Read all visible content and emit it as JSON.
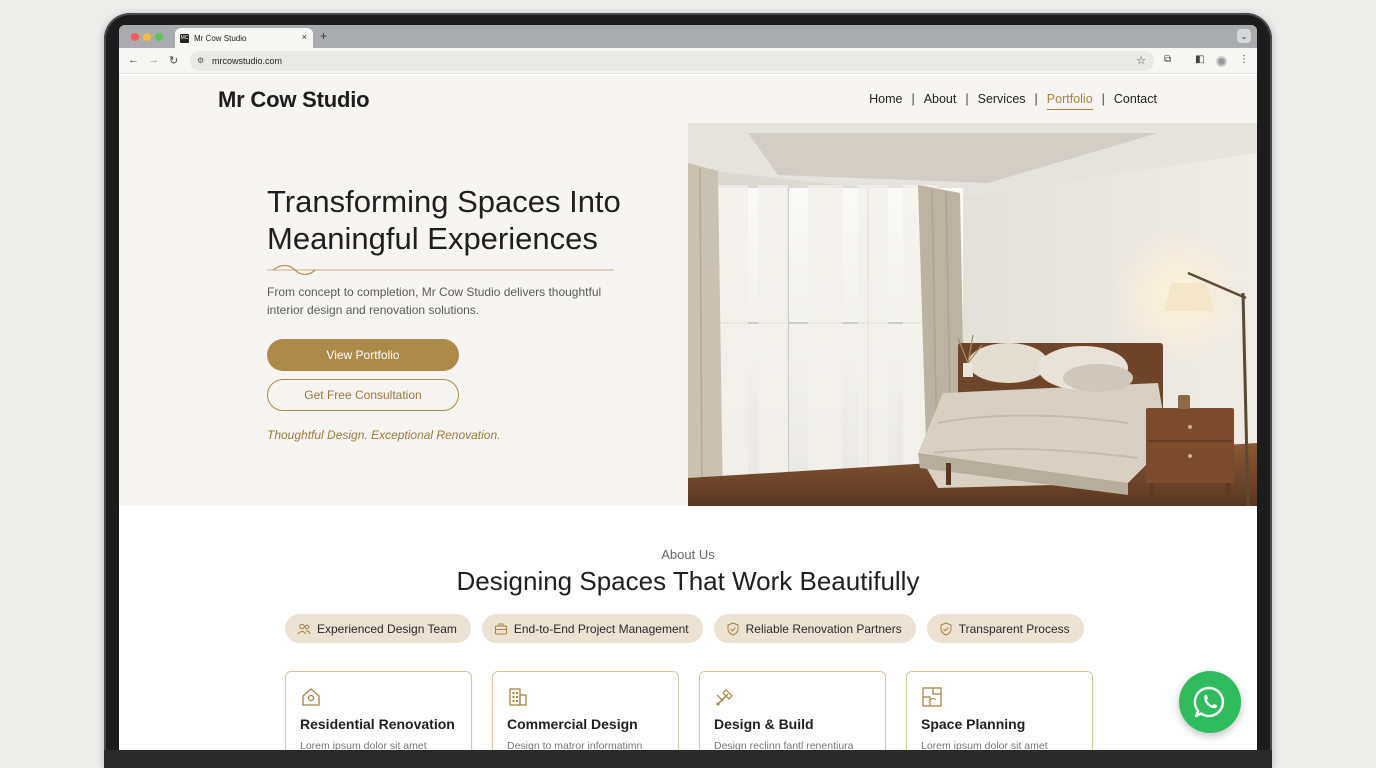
{
  "browser": {
    "tab_title": "Mr Cow Studio",
    "favicon_text": "MC",
    "tab_close": "×",
    "new_tab": "+",
    "url": "mrcowstudio.com"
  },
  "site": {
    "brand": "Mr Cow Studio",
    "nav": [
      {
        "label": "Home"
      },
      {
        "label": "About"
      },
      {
        "label": "Services"
      },
      {
        "label": "Portfolio",
        "active": true
      },
      {
        "label": "Contact"
      }
    ],
    "nav_separator": "|"
  },
  "hero": {
    "title_line1": "Transforming Spaces Into",
    "title_line2": "Meaningful Experiences",
    "text_line1": "From concept to completion, Mr Cow Studio delivers thoughtful",
    "text_line2": "interior design and renovation solutions.",
    "primary_button": "View Portfolio",
    "secondary_button": "Get Free Consultation",
    "tagline": "Thoughtful Design. Exceptional Renovation."
  },
  "about": {
    "eyebrow": "About Us",
    "title": "Designing Spaces That Work Beautifully",
    "pills": [
      {
        "label": "Experienced Design Team",
        "icon": "people-icon"
      },
      {
        "label": "End-to-End Project Management",
        "icon": "briefcase-icon"
      },
      {
        "label": "Reliable Renovation Partners",
        "icon": "shield-check-icon"
      },
      {
        "label": "Transparent Process",
        "icon": "shield-check-icon"
      }
    ],
    "cards": [
      {
        "title": "Residential Renovation",
        "text": "Lorem ipsum dolor sit amet",
        "icon": "house-icon"
      },
      {
        "title": "Commercial Design",
        "text": "Design to matror informatimn",
        "icon": "building-icon"
      },
      {
        "title": "Design & Build",
        "text": "Design reclinn fantl renentiura",
        "icon": "tools-icon"
      },
      {
        "title": "Space Planning",
        "text": "Lorem ipsum dolor sit amet",
        "icon": "floorplan-icon"
      }
    ]
  },
  "colors": {
    "accent": "#ae8a4a",
    "pill_bg": "#ebe2d4",
    "hero_bg": "#f6f5f2",
    "whatsapp": "#2fbc5d"
  }
}
